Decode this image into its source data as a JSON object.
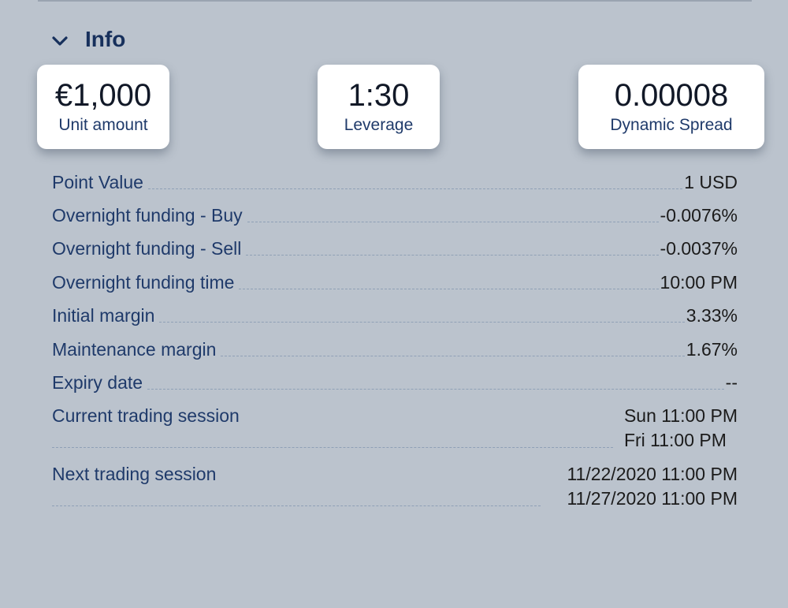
{
  "section": {
    "title": "Info"
  },
  "cards": {
    "unit_amount": {
      "value": "€1,000",
      "label": "Unit amount"
    },
    "leverage": {
      "value": "1:30",
      "label": "Leverage"
    },
    "spread": {
      "value": "0.00008",
      "label": "Dynamic Spread"
    }
  },
  "details": {
    "point_value": {
      "label": "Point Value",
      "value": "1 USD"
    },
    "overnight_buy": {
      "label": "Overnight funding - Buy",
      "value": "-0.0076%"
    },
    "overnight_sell": {
      "label": "Overnight funding - Sell",
      "value": "-0.0037%"
    },
    "overnight_time": {
      "label": "Overnight funding time",
      "value": "10:00 PM"
    },
    "initial_margin": {
      "label": "Initial margin",
      "value": "3.33%"
    },
    "maintenance_margin": {
      "label": "Maintenance margin",
      "value": "1.67%"
    },
    "expiry_date": {
      "label": "Expiry date",
      "value": "--"
    },
    "current_session": {
      "label": "Current trading session",
      "start": "Sun 11:00 PM",
      "end": "Fri 11:00 PM"
    },
    "next_session": {
      "label": "Next trading session",
      "start": "11/22/2020 11:00 PM",
      "end": "11/27/2020 11:00 PM"
    }
  },
  "icons": {
    "collapse": "chevron-down-icon"
  },
  "colors": {
    "background": "#bbc3cd",
    "heading": "#17305c",
    "label": "#1f3a6a",
    "card": "#ffffff"
  }
}
